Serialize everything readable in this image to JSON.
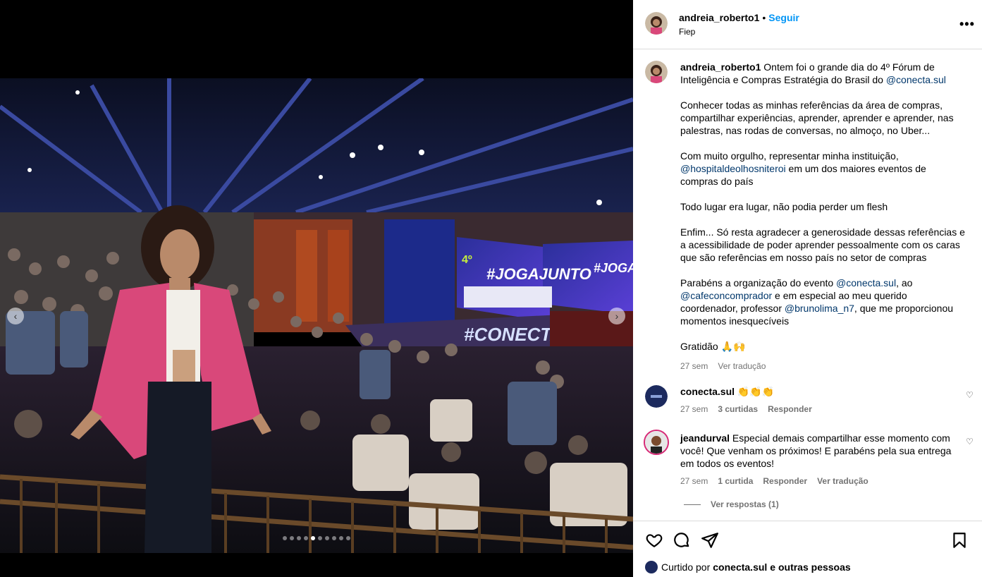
{
  "post": {
    "author": "andreia_roberto1",
    "follow_label": "Seguir",
    "location": "Fiep",
    "more_label": "•••"
  },
  "caption": {
    "author": "andreia_roberto1",
    "p1_text": "Ontem foi o grande dia do 4º Fórum de Inteligência e Compras Estratégia do Brasil do ",
    "p1_mention": "@conecta.sul",
    "p2": "Conhecer todas as minhas referências da área de compras, compartilhar experiências, aprender, aprender e aprender, nas palestras, nas rodas de conversas, no almoço, no Uber...",
    "p3_a": "Com muito orgulho, representar minha instituição, ",
    "p3_mention": "@hospitaldeolhosniteroi",
    "p3_b": " em um dos maiores eventos de compras do país",
    "p4": "Todo lugar era lugar, não podia perder um flesh",
    "p5": "Enfim... Só resta agradecer a generosidade dessas referências e a acessibilidade de poder aprender pessoalmente com os caras que são referências em nosso país no setor de compras",
    "p6_a": "Parabéns a organização do evento ",
    "p6_m1": "@conecta.sul",
    "p6_b": ", ao ",
    "p6_m2": "@cafeconcomprador",
    "p6_c": " e em especial ao meu querido coordenador, professor ",
    "p6_m3": "@brunolima_n7",
    "p6_d": ", que me proporcionou momentos inesquecíveis",
    "p7": "Gratidão 🙏🙌",
    "time": "27 sem",
    "translate": "Ver tradução"
  },
  "comments": [
    {
      "user": "conecta.sul",
      "text": "👏👏👏",
      "time": "27 sem",
      "likes": "3 curtidas",
      "reply": "Responder"
    },
    {
      "user": "jeandurval",
      "text": "Especial demais compartilhar esse momento com você! Que venham os próximos! E parabéns pela sua entrega em todos os eventos!",
      "time": "27 sem",
      "likes": "1 curtida",
      "reply": "Responder",
      "translate": "Ver tradução",
      "view_replies": "Ver respostas (1)"
    }
  ],
  "likes_summary": {
    "prefix": "Curtido por ",
    "user": "conecta.sul",
    "suffix": " e outras pessoas"
  },
  "photo_text": {
    "screen_left": "#JOGAJUNTO",
    "screen_right": "#JOGAJUNTO",
    "stage": "#CONECTA",
    "forum_num": "4º"
  },
  "icons": {
    "prev": "‹",
    "next": "›",
    "heart": "♡"
  }
}
